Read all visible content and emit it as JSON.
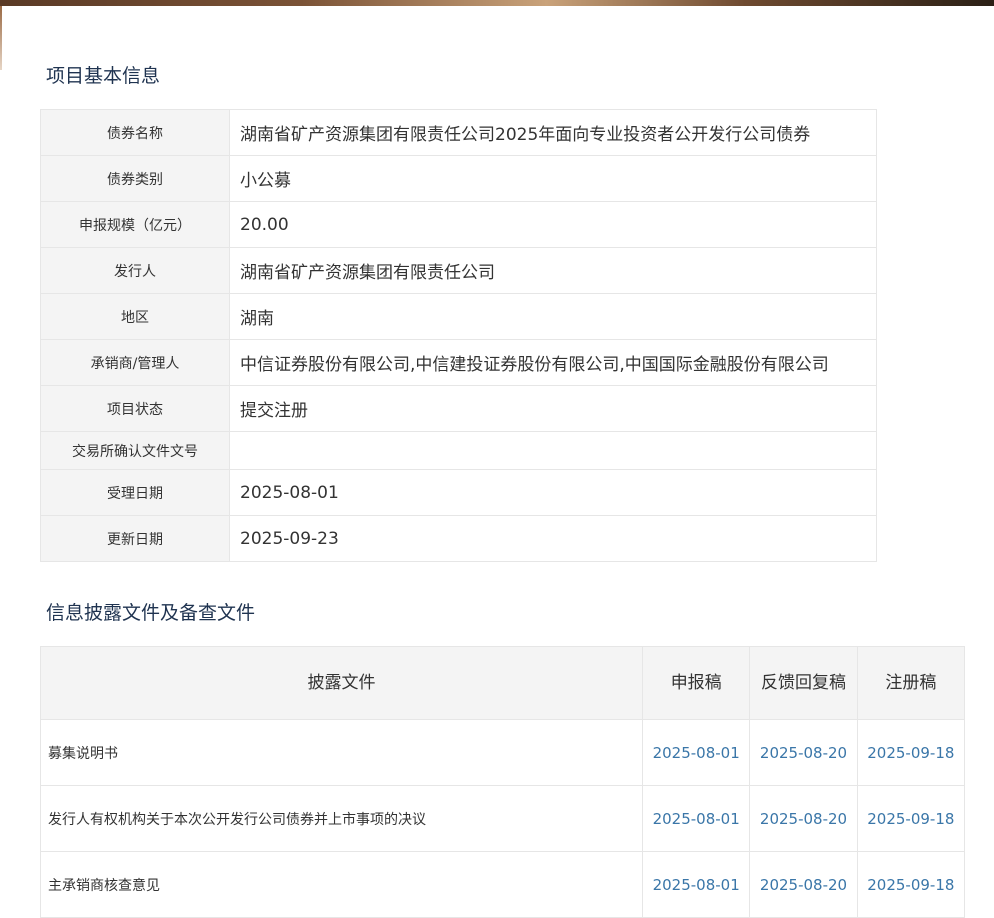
{
  "section1": {
    "title": "项目基本信息"
  },
  "info": [
    {
      "label": "债券名称",
      "value": "湖南省矿产资源集团有限责任公司2025年面向专业投资者公开发行公司债券"
    },
    {
      "label": "债券类别",
      "value": "小公募"
    },
    {
      "label": "申报规模（亿元）",
      "value": "20.00"
    },
    {
      "label": "发行人",
      "value": "湖南省矿产资源集团有限责任公司"
    },
    {
      "label": "地区",
      "value": "湖南"
    },
    {
      "label": "承销商/管理人",
      "value": "中信证券股份有限公司,中信建投证券股份有限公司,中国国际金融股份有限公司"
    },
    {
      "label": "项目状态",
      "value": "提交注册"
    },
    {
      "label": "交易所确认文件文号",
      "value": ""
    },
    {
      "label": "受理日期",
      "value": "2025-08-01"
    },
    {
      "label": "更新日期",
      "value": "2025-09-23"
    }
  ],
  "section2": {
    "title": "信息披露文件及备查文件"
  },
  "docs": {
    "headers": [
      "披露文件",
      "申报稿",
      "反馈回复稿",
      "注册稿"
    ],
    "rows": [
      {
        "name": "募集说明书",
        "d1": "2025-08-01",
        "d2": "2025-08-20",
        "d3": "2025-09-18"
      },
      {
        "name": "发行人有权机构关于本次公开发行公司债券并上市事项的决议",
        "d1": "2025-08-01",
        "d2": "2025-08-20",
        "d3": "2025-09-18"
      },
      {
        "name": "主承销商核查意见",
        "d1": "2025-08-01",
        "d2": "2025-08-20",
        "d3": "2025-09-18"
      }
    ]
  }
}
